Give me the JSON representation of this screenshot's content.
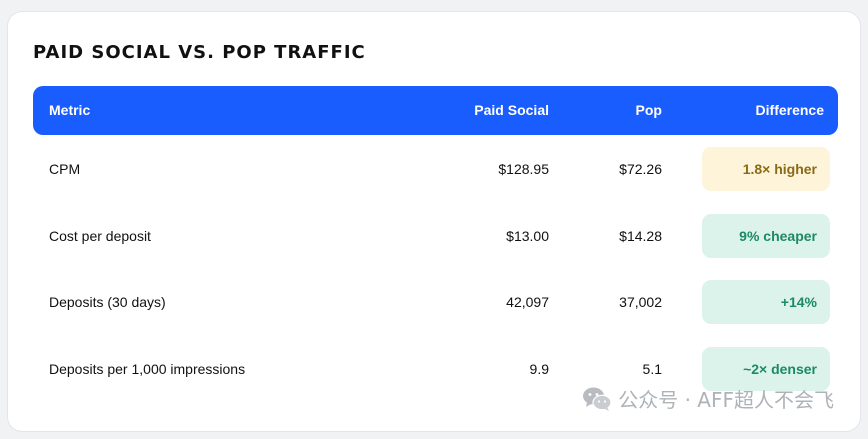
{
  "title": "PAID SOCIAL VS. POP TRAFFIC",
  "columns": {
    "metric": "Metric",
    "paid_social": "Paid Social",
    "pop": "Pop",
    "difference": "Difference"
  },
  "rows": [
    {
      "metric": "CPM",
      "paid_social": "$128.95",
      "pop": "$72.26",
      "difference": "1.8× higher",
      "status": "warn"
    },
    {
      "metric": "Cost per deposit",
      "paid_social": "$13.00",
      "pop": "$14.28",
      "difference": "9% cheaper",
      "status": "good"
    },
    {
      "metric": "Deposits (30 days)",
      "paid_social": "42,097",
      "pop": "37,002",
      "difference": "+14%",
      "status": "good"
    },
    {
      "metric": "Deposits per 1,000 impressions",
      "paid_social": "9.9",
      "pop": "5.1",
      "difference": "~2× denser",
      "status": "good"
    }
  ],
  "watermark": {
    "icon": "wechat-icon",
    "text": "公众号 · AFF超人不会飞"
  },
  "colors": {
    "header_bg": "#1a5dff",
    "warn_bg": "#fdf4d9",
    "warn_text": "#8a6a17",
    "good_bg": "#dcf3ec",
    "good_text": "#1c8a63"
  }
}
